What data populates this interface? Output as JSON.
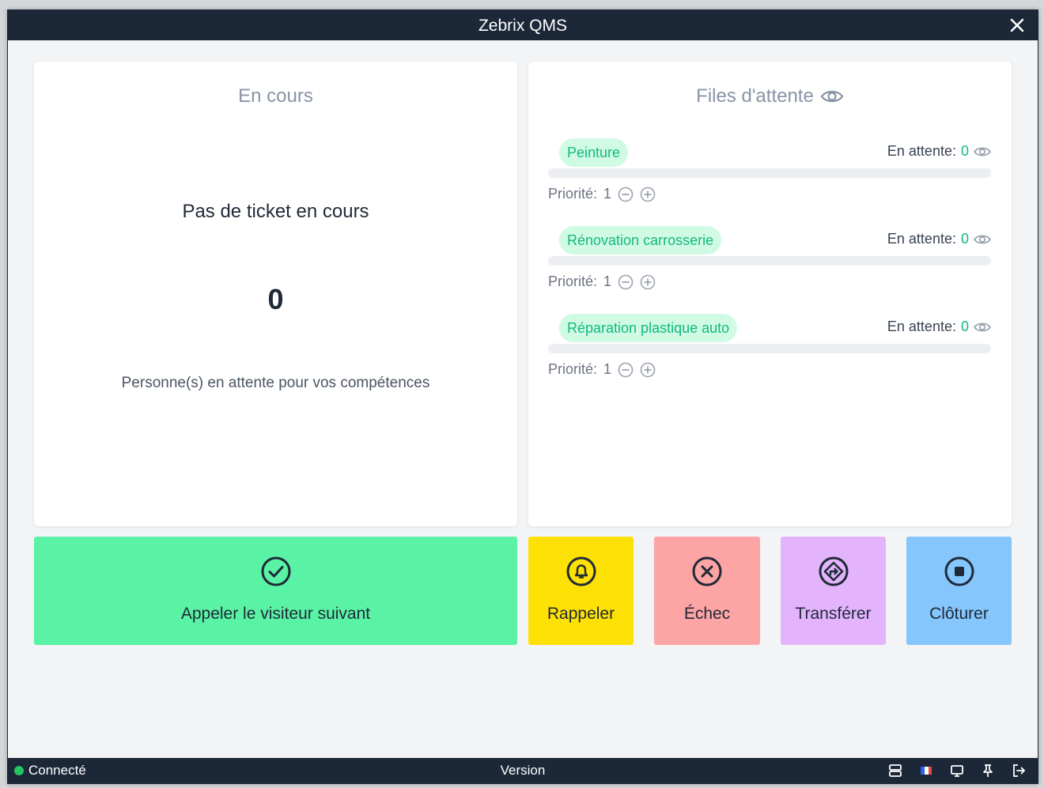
{
  "window": {
    "title": "Zebrix QMS"
  },
  "current": {
    "heading": "En cours",
    "no_ticket": "Pas de ticket en cours",
    "waiting_count": "0",
    "waiting_label": "Personne(s) en attente pour vos compétences"
  },
  "queues": {
    "heading": "Files d'attente",
    "waiting_label": "En attente:",
    "priority_label": "Priorité:",
    "items": [
      {
        "name": "Peinture",
        "waiting": "0",
        "priority": "1"
      },
      {
        "name": "Rénovation carrosserie",
        "waiting": "0",
        "priority": "1"
      },
      {
        "name": "Réparation plastique auto",
        "waiting": "0",
        "priority": "1"
      }
    ]
  },
  "actions": {
    "next": "Appeler le visiteur suivant",
    "recall": "Rappeler",
    "fail": "Échec",
    "transfer": "Transférer",
    "close": "Clôturer"
  },
  "status": {
    "connection": "Connecté",
    "version": "Version"
  },
  "colors": {
    "accent_green": "#10b981",
    "next": "#5af2a4",
    "recall": "#fde004",
    "fail": "#fda4a4",
    "transfer": "#e3b4fb",
    "close": "#85c6fc",
    "titlebar": "#1c2738"
  }
}
